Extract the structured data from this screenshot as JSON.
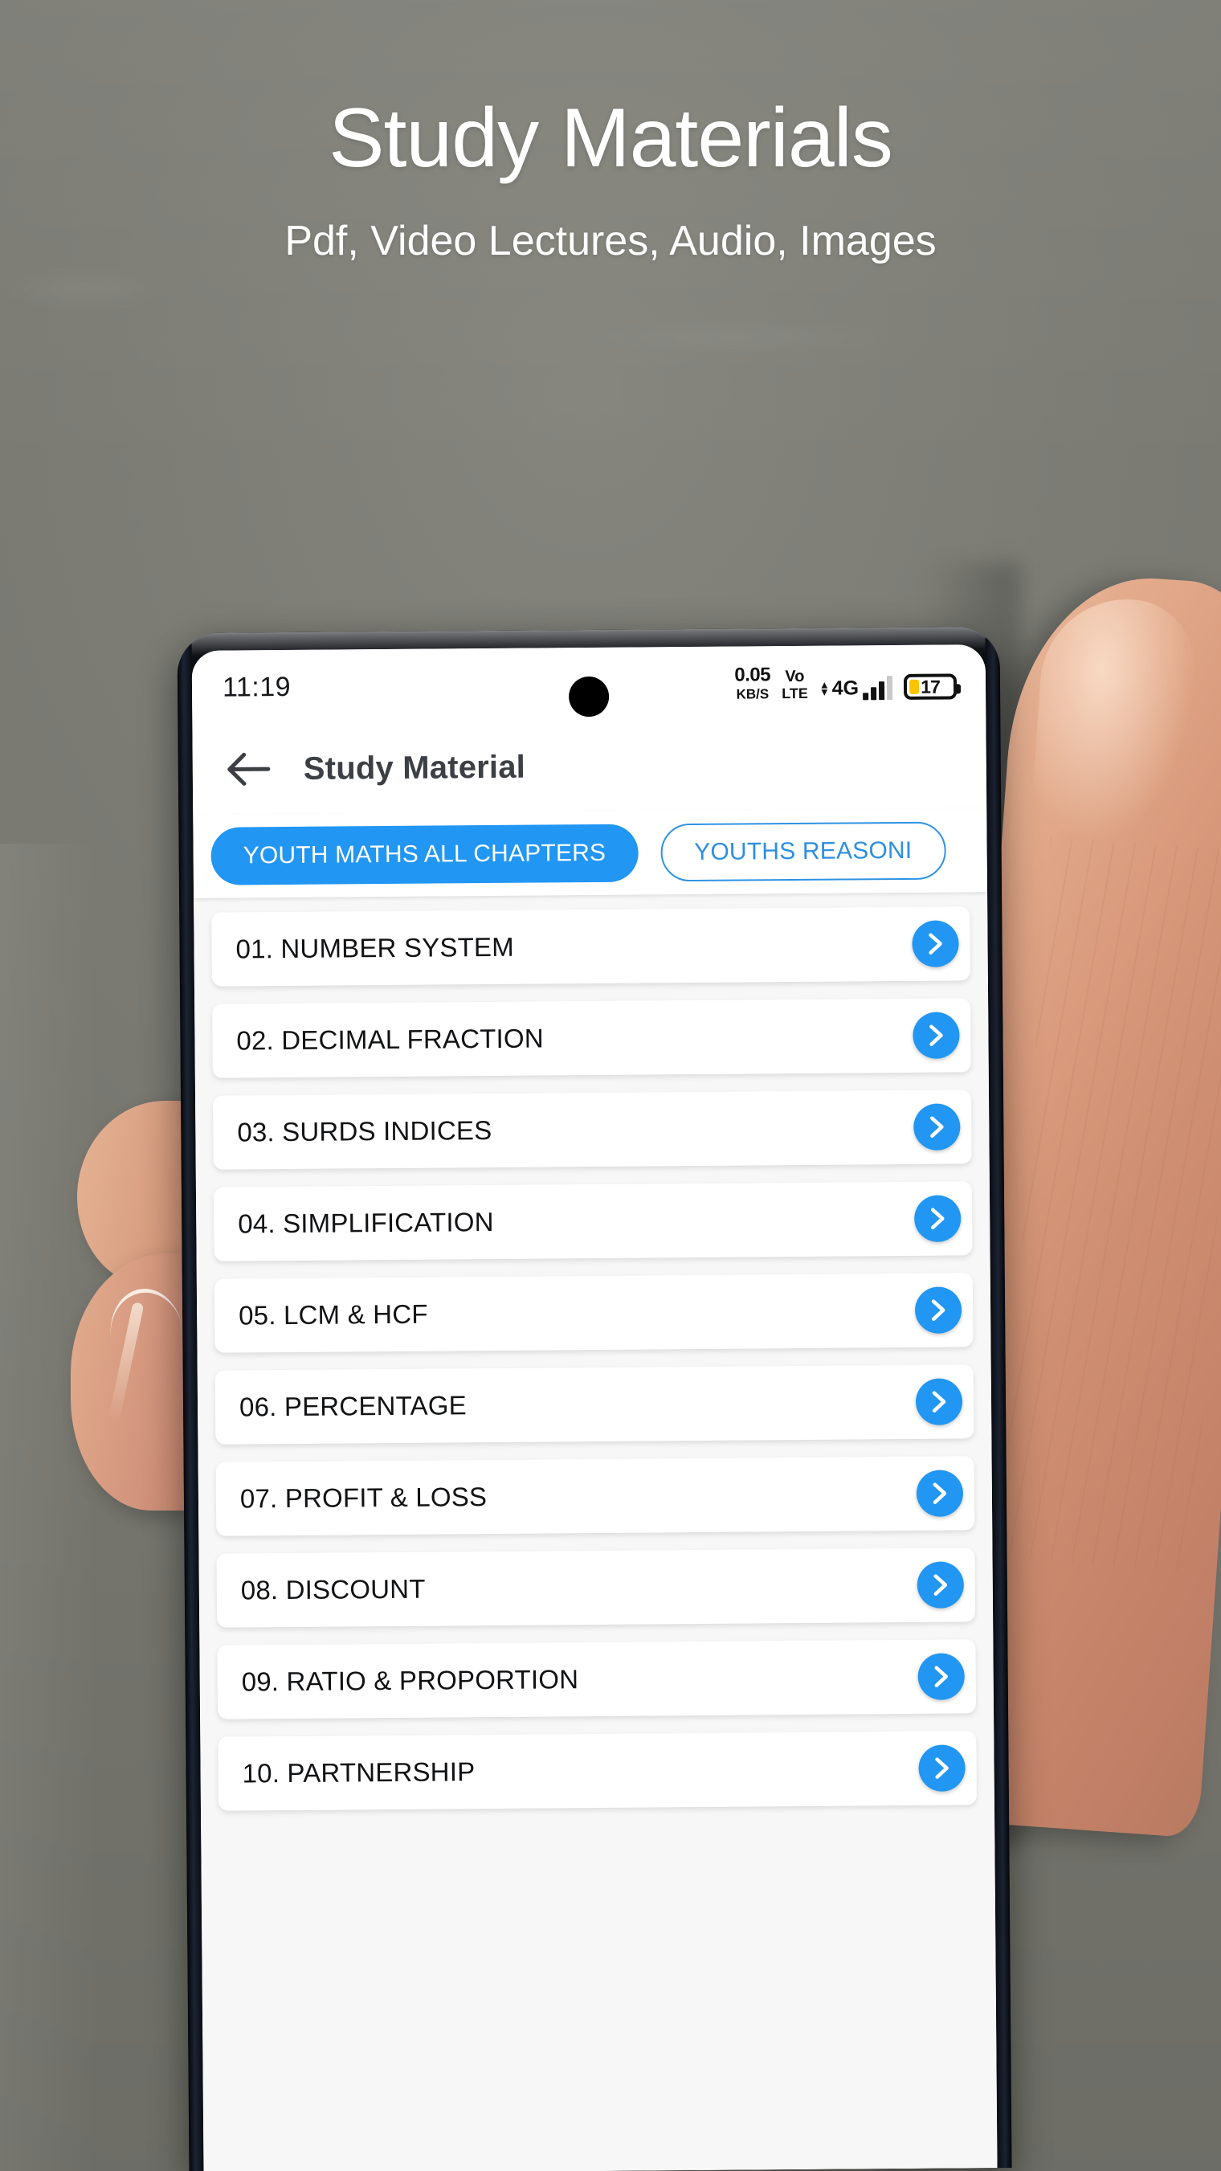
{
  "promo": {
    "title": "Study Materials",
    "subtitle": "Pdf, Video Lectures, Audio, Images"
  },
  "colors": {
    "accent": "#2196f3",
    "chip_inactive_text": "#2d8fe0",
    "battery_fill": "#ffc400",
    "background_wall": "#7b7b74",
    "list_background": "#f7f7f7"
  },
  "statusbar": {
    "clock": "11:19",
    "network_speed_value": "0.05",
    "network_speed_unit": "KB/S",
    "volte_line1": "Vo",
    "volte_line2": "LTE",
    "network_type": "4G",
    "battery_level": "17"
  },
  "appbar": {
    "back_icon": "arrow-left-icon",
    "title": "Study Material"
  },
  "tabs": [
    {
      "label": "YOUTH MATHS ALL CHAPTERS",
      "active": true
    },
    {
      "label": "YOUTHS REASONI",
      "active": false
    }
  ],
  "chapters": [
    {
      "label": "01. NUMBER SYSTEM"
    },
    {
      "label": "02. DECIMAL FRACTION"
    },
    {
      "label": "03. SURDS INDICES"
    },
    {
      "label": "04. SIMPLIFICATION"
    },
    {
      "label": "05. LCM & HCF"
    },
    {
      "label": "06. PERCENTAGE"
    },
    {
      "label": "07. PROFIT & LOSS"
    },
    {
      "label": "08. DISCOUNT"
    },
    {
      "label": "09. RATIO & PROPORTION"
    },
    {
      "label": "10. PARTNERSHIP"
    }
  ],
  "icons": {
    "chevron_right": "chevron-right-icon",
    "camera_punchhole": "front-camera-icon"
  }
}
